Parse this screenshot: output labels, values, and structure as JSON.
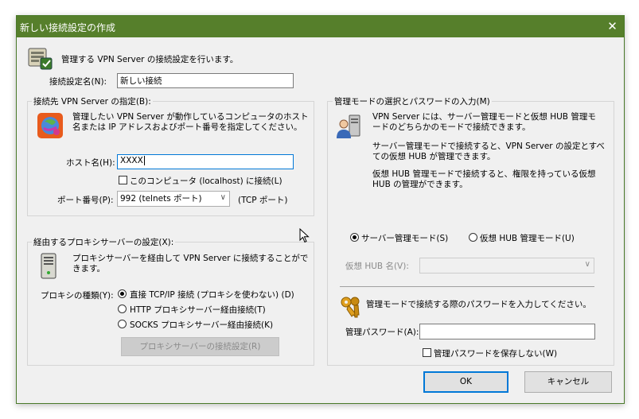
{
  "window": {
    "title": "新しい接続設定の作成",
    "close_glyph": "✕"
  },
  "header": {
    "description": "管理する VPN Server の接続設定を行います。"
  },
  "setting_name": {
    "label": "接続設定名(N):",
    "value": "新しい接続"
  },
  "destination": {
    "group_title": "接続先 VPN Server の指定(B):",
    "description_line1": "管理したい VPN Server が動作しているコンピュータのホスト",
    "description_line2": "名または IP アドレスおよびポート番号を指定してください。",
    "host_label": "ホスト名(H):",
    "host_value": "XXXX",
    "local_checkbox_label": "このコンピュータ (localhost) に接続(L)",
    "local_checked": false,
    "port_label": "ポート番号(P):",
    "port_value": "992 (telnets ポート)",
    "port_suffix": "(TCP ポート)"
  },
  "proxy": {
    "group_title": "経由するプロキシサーバーの設定(X):",
    "description_line1": "プロキシサーバーを経由して VPN Server に接続することがで",
    "description_line2": "きます。",
    "type_label": "プロキシの種類(Y):",
    "options": [
      "直接 TCP/IP 接続 (プロキシを使わない) (D)",
      "HTTP プロキシサーバー経由接続(T)",
      "SOCKS プロキシサーバー経由接続(K)"
    ],
    "selected_index": 0,
    "settings_button": "プロキシサーバーの接続設定(R)"
  },
  "admin": {
    "group_title": "管理モードの選択とパスワードの入力(M)",
    "para1_line1": "VPN Server には、サーバー管理モードと仮想 HUB 管理モ",
    "para1_line2": "ードのどちらかのモードで接続できます。",
    "para2_line1": "サーバー管理モードで接続すると、VPN Server の設定とすべ",
    "para2_line2": "ての仮想 HUB が管理できます。",
    "para3_line1": "仮想 HUB 管理モードで接続すると、権限を持っている仮想",
    "para3_line2": "HUB の管理ができます。",
    "mode_server": "サーバー管理モード(S)",
    "mode_hub": "仮想 HUB 管理モード(U)",
    "selected_mode": "server",
    "hub_name_label": "仮想 HUB 名(V):",
    "hub_name_value": "",
    "password_prompt": "管理モードで接続する際のパスワードを入力してください。",
    "password_label": "管理パスワード(A):",
    "password_value": "",
    "no_save_label": "管理パスワードを保存しない(W)",
    "no_save_checked": false
  },
  "buttons": {
    "ok": "OK",
    "cancel": "キャンセル"
  },
  "icons": {
    "header": "server-setup-icon",
    "destination": "network-globe-icon",
    "proxy": "server-tower-icon",
    "admin": "admin-user-icon",
    "password": "keys-icon",
    "cursor": "mouse-pointer-icon"
  }
}
